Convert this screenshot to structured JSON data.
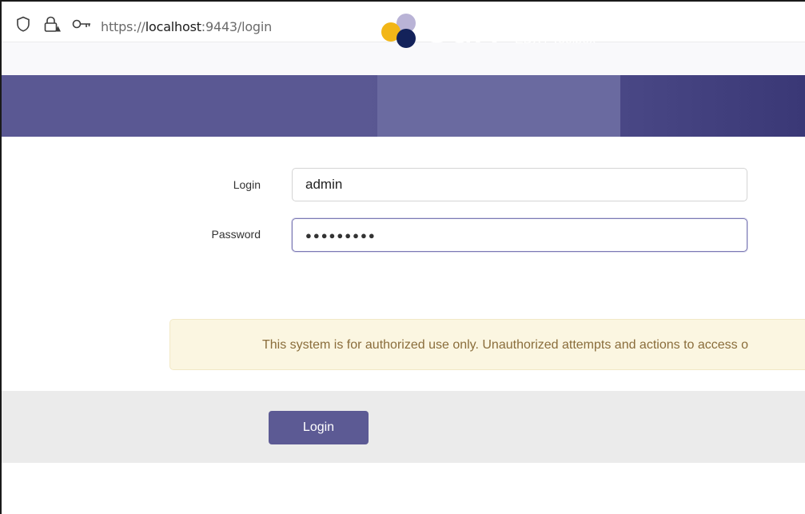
{
  "browser": {
    "url_scheme": "https://",
    "url_host": "localhost",
    "url_rest": ":9443/login",
    "icons": [
      "shield-icon",
      "lock-warning-icon",
      "key-icon"
    ]
  },
  "header": {
    "brand_name": "edx",
    "brand_subtitle": "EDX / Toolbox",
    "colors": {
      "bar": "#5a5893",
      "bar_dark": "#3a3876",
      "brand_block": "#6a6aa0",
      "logo_yellow": "#f2b617",
      "logo_navy": "#13225a",
      "logo_lilac": "#b9b3d6"
    }
  },
  "form": {
    "login_label": "Login",
    "login_value": "admin",
    "password_label": "Password",
    "password_mask": "●●●●●●●●●"
  },
  "notice": {
    "text": "This system is for authorized use only. Unauthorized attempts and actions to access o",
    "colors": {
      "bg": "#fbf6e1",
      "text": "#8a6d3b"
    }
  },
  "actions": {
    "login_button": "Login",
    "button_color": "#5c5a94"
  }
}
